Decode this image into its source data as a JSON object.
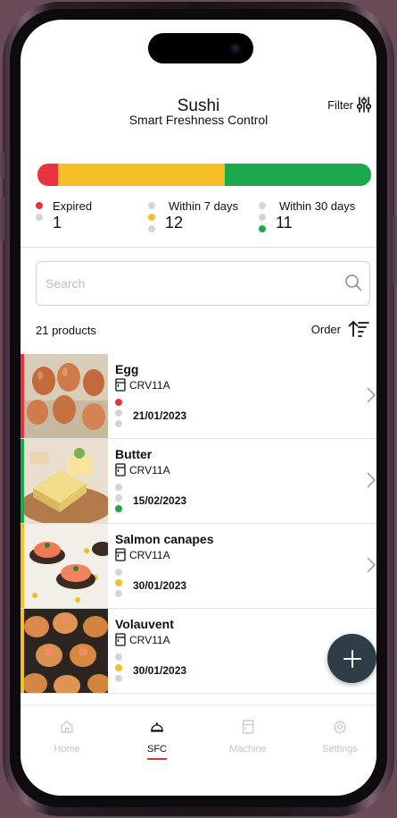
{
  "header": {
    "title": "Sushi",
    "subtitle": "Smart Freshness Control",
    "filter_label": "Filter"
  },
  "colors": {
    "expired": "#e8323c",
    "within_7": "#f6bf26",
    "within_30": "#1ba94c",
    "inactive": "#d5d5d5",
    "fab": "#2e3e48"
  },
  "freshness_bar": {
    "expired_fraction": 0.0625,
    "within_7_fraction": 0.5,
    "within_30_fraction": 0.4375
  },
  "stats": [
    {
      "label": "Expired",
      "count": "1"
    },
    {
      "label": "Within 7 days",
      "count": "12"
    },
    {
      "label": "Within 30 days",
      "count": "11"
    }
  ],
  "search": {
    "placeholder": "Search",
    "value": ""
  },
  "list_header": {
    "count_label": "21 products",
    "order_label": "Order"
  },
  "products": [
    {
      "name": "Egg",
      "machine": "CRV11A",
      "date": "21/01/2023",
      "status": "expired"
    },
    {
      "name": "Butter",
      "machine": "CRV11A",
      "date": "15/02/2023",
      "status": "within_30"
    },
    {
      "name": "Salmon canapes",
      "machine": "CRV11A",
      "date": "30/01/2023",
      "status": "within_7"
    },
    {
      "name": "Volauvent",
      "machine": "CRV11A",
      "date": "30/01/2023",
      "status": "within_7"
    }
  ],
  "tabs": [
    {
      "label": "Home",
      "icon": "home-icon",
      "active": false
    },
    {
      "label": "SFC",
      "icon": "food-cover-icon",
      "active": true
    },
    {
      "label": "Machine",
      "icon": "machine-icon",
      "active": false
    },
    {
      "label": "Settings",
      "icon": "gear-icon",
      "active": false
    }
  ]
}
